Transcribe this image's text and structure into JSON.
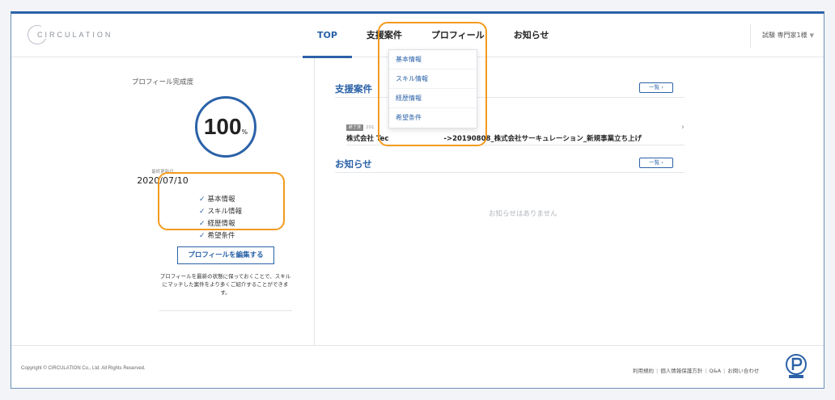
{
  "header": {
    "logo_text": "CIRCULATION",
    "nav": [
      {
        "label": "TOP",
        "active": true
      },
      {
        "label": "支援案件",
        "active": false
      },
      {
        "label": "プロフィール",
        "active": false
      },
      {
        "label": "お知らせ",
        "active": false
      }
    ],
    "user_label": "試験 専門家1様"
  },
  "profile_menu": {
    "items": [
      "基本情報",
      "スキル情報",
      "経歴情報",
      "希望条件"
    ]
  },
  "profile_panel": {
    "title": "プロフィール完成度",
    "completion_value": "100",
    "completion_unit": "%",
    "updated_label": "最終更新日",
    "updated_date": "2020/07/10",
    "checklist": [
      "基本情報",
      "スキル情報",
      "経歴情報",
      "希望条件"
    ],
    "edit_button": "プロフィールを編集する",
    "note": "プロフィールを最新の状態に保っておくことで、スキルにマッチした案件をより多くご紹介することができます。"
  },
  "cases": {
    "title": "支援案件",
    "more_label": "一覧",
    "items": [
      {
        "badge": "終了済",
        "date": "201",
        "name_prefix": "株式会社 Tec",
        "name_suffix": "->20190808_株式会社サーキュレーション_新規事業立ち上げ"
      }
    ]
  },
  "news": {
    "title": "お知らせ",
    "more_label": "一覧",
    "empty_message": "お知らせはありません"
  },
  "footer": {
    "copyright": "Copyright © CIRCULATION Co., Ltd. All Rights Reserved.",
    "links": [
      "利用規約",
      "個人情報保護方針",
      "Q&A",
      "お問い合わせ"
    ]
  },
  "colors": {
    "brand": "#2b62a8",
    "highlight": "#f39a1e"
  }
}
